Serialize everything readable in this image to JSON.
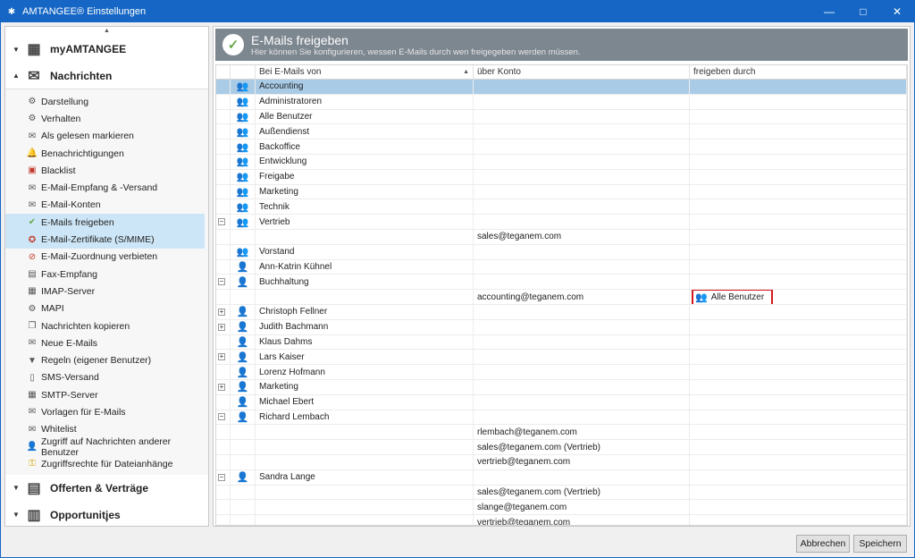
{
  "window": {
    "title": "AMTANGEE® Einstellungen",
    "minimize": "—",
    "maximize": "□",
    "close": "✕"
  },
  "sidebar": {
    "sections": [
      {
        "label": "myAMTANGEE",
        "expanded": false
      },
      {
        "label": "Nachrichten",
        "expanded": true
      },
      {
        "label": "Offerten & Verträge",
        "expanded": false
      },
      {
        "label": "Opportunities",
        "expanded": false
      }
    ],
    "items": [
      {
        "label": "Darstellung",
        "icon": "gear-icon"
      },
      {
        "label": "Verhalten",
        "icon": "gear-icon"
      },
      {
        "label": "Als gelesen markieren",
        "icon": "envelope-icon"
      },
      {
        "label": "Benachrichtigungen",
        "icon": "bell-icon"
      },
      {
        "label": "Blacklist",
        "icon": "blacklist-icon"
      },
      {
        "label": "E-Mail-Empfang & -Versand",
        "icon": "mail-send-icon"
      },
      {
        "label": "E-Mail-Konten",
        "icon": "mail-account-icon"
      },
      {
        "label": "E-Mails freigeben",
        "icon": "check-circle-icon"
      },
      {
        "label": "E-Mail-Zertifikate (S/MIME)",
        "icon": "certificate-icon"
      },
      {
        "label": "E-Mail-Zuordnung verbieten",
        "icon": "forbid-icon"
      },
      {
        "label": "Fax-Empfang",
        "icon": "fax-icon"
      },
      {
        "label": "IMAP-Server",
        "icon": "server-icon"
      },
      {
        "label": "MAPI",
        "icon": "gear-icon"
      },
      {
        "label": "Nachrichten kopieren",
        "icon": "copy-icon"
      },
      {
        "label": "Neue E-Mails",
        "icon": "new-mail-icon"
      },
      {
        "label": "Regeln (eigener Benutzer)",
        "icon": "filter-icon"
      },
      {
        "label": "SMS-Versand",
        "icon": "sms-icon"
      },
      {
        "label": "SMTP-Server",
        "icon": "server-icon"
      },
      {
        "label": "Vorlagen für E-Mails",
        "icon": "template-icon"
      },
      {
        "label": "Whitelist",
        "icon": "envelope-icon"
      },
      {
        "label": "Zugriff auf Nachrichten anderer Benutzer",
        "icon": "user-icon"
      },
      {
        "label": "Zugriffsrechte für Dateianhänge",
        "icon": "key-icon"
      }
    ]
  },
  "banner": {
    "title": "E-Mails freigeben",
    "subtitle": "Hier können Sie konfigurieren, wessen E-Mails durch wen freigegeben werden müssen."
  },
  "grid": {
    "columns": [
      "Bei E-Mails von",
      "über Konto",
      "freigeben durch"
    ],
    "rows": [
      {
        "exp": "",
        "icon": "group-icon",
        "name": "Accounting",
        "account": "",
        "by": "",
        "selected": true
      },
      {
        "exp": "",
        "icon": "group-icon",
        "name": "Administratoren",
        "account": "",
        "by": ""
      },
      {
        "exp": "",
        "icon": "group-icon",
        "name": "Alle Benutzer",
        "account": "",
        "by": ""
      },
      {
        "exp": "",
        "icon": "group-icon",
        "name": "Außendienst",
        "account": "",
        "by": ""
      },
      {
        "exp": "",
        "icon": "group-icon",
        "name": "Backoffice",
        "account": "",
        "by": ""
      },
      {
        "exp": "",
        "icon": "group-icon",
        "name": "Entwicklung",
        "account": "",
        "by": ""
      },
      {
        "exp": "",
        "icon": "group-icon",
        "name": "Freigabe",
        "account": "",
        "by": ""
      },
      {
        "exp": "",
        "icon": "group-icon",
        "name": "Marketing",
        "account": "",
        "by": ""
      },
      {
        "exp": "",
        "icon": "group-icon",
        "name": "Technik",
        "account": "",
        "by": ""
      },
      {
        "exp": "−",
        "icon": "group-icon",
        "name": "Vertrieb",
        "account": "",
        "by": ""
      },
      {
        "exp": "",
        "icon": "",
        "name": "",
        "account": "sales@teganem.com",
        "by": ""
      },
      {
        "exp": "",
        "icon": "group-icon",
        "name": "Vorstand",
        "account": "",
        "by": ""
      },
      {
        "exp": "",
        "icon": "user-icon",
        "name": "Ann-Katrin Kühnel",
        "account": "",
        "by": ""
      },
      {
        "exp": "−",
        "icon": "user-icon",
        "name": "Buchhaltung",
        "account": "",
        "by": ""
      },
      {
        "exp": "",
        "icon": "",
        "name": "",
        "account": "accounting@teganem.com",
        "by": "Alle Benutzer",
        "highlight": true
      },
      {
        "exp": "+",
        "icon": "user-icon",
        "name": "Christoph Fellner",
        "account": "",
        "by": ""
      },
      {
        "exp": "+",
        "icon": "user-icon",
        "name": "Judith Bachmann",
        "account": "",
        "by": ""
      },
      {
        "exp": "",
        "icon": "user-icon",
        "name": "Klaus Dahms",
        "account": "",
        "by": ""
      },
      {
        "exp": "+",
        "icon": "user-icon",
        "name": "Lars Kaiser",
        "account": "",
        "by": ""
      },
      {
        "exp": "",
        "icon": "user-icon",
        "name": "Lorenz Hofmann",
        "account": "",
        "by": ""
      },
      {
        "exp": "+",
        "icon": "user-icon",
        "name": "Marketing",
        "account": "",
        "by": ""
      },
      {
        "exp": "",
        "icon": "user-icon",
        "name": "Michael Ebert",
        "account": "",
        "by": ""
      },
      {
        "exp": "−",
        "icon": "user-icon",
        "name": "Richard Lembach",
        "account": "",
        "by": ""
      },
      {
        "exp": "",
        "icon": "",
        "name": "",
        "account": "rlembach@teganem.com",
        "by": ""
      },
      {
        "exp": "",
        "icon": "",
        "name": "",
        "account": "sales@teganem.com (Vertrieb)",
        "by": ""
      },
      {
        "exp": "",
        "icon": "",
        "name": "",
        "account": "vertrieb@teganem.com",
        "by": ""
      },
      {
        "exp": "−",
        "icon": "user-icon",
        "name": "Sandra Lange",
        "account": "",
        "by": ""
      },
      {
        "exp": "",
        "icon": "",
        "name": "",
        "account": "sales@teganem.com (Vertrieb)",
        "by": ""
      },
      {
        "exp": "",
        "icon": "",
        "name": "",
        "account": "slange@teganem.com",
        "by": ""
      },
      {
        "exp": "",
        "icon": "",
        "name": "",
        "account": "vertrieb@teganem.com",
        "by": ""
      }
    ]
  },
  "footer": {
    "cancel": "Abbrechen",
    "save": "Speichern"
  }
}
